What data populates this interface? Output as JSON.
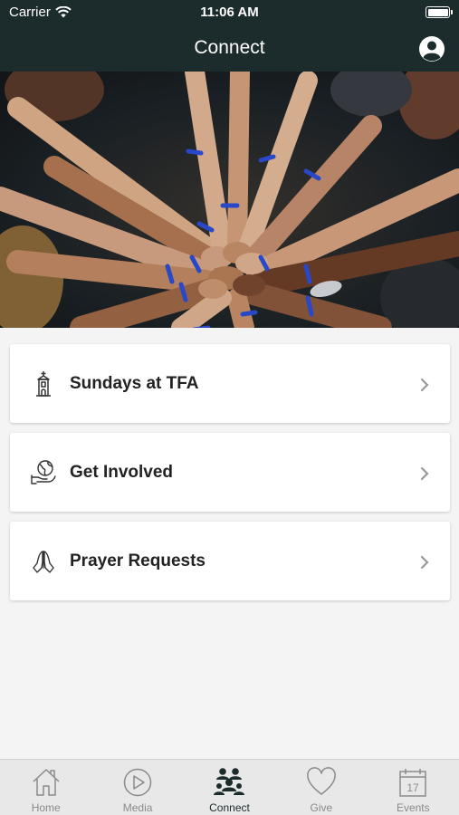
{
  "status_bar": {
    "carrier": "Carrier",
    "time": "11:06 AM"
  },
  "nav": {
    "title": "Connect"
  },
  "cards": [
    {
      "label": "Sundays at TFA",
      "icon": "church-icon"
    },
    {
      "label": "Get Involved",
      "icon": "globe-hand-icon"
    },
    {
      "label": "Prayer Requests",
      "icon": "praying-hands-icon"
    }
  ],
  "tabs": [
    {
      "label": "Home",
      "icon": "home-icon",
      "active": false
    },
    {
      "label": "Media",
      "icon": "play-icon",
      "active": false
    },
    {
      "label": "Connect",
      "icon": "people-icon",
      "active": true
    },
    {
      "label": "Give",
      "icon": "heart-icon",
      "active": false
    },
    {
      "label": "Events",
      "icon": "calendar-icon",
      "active": false
    }
  ],
  "calendar_day": "17",
  "colors": {
    "header": "#1c2b2b",
    "tab_active": "#1c2b2b",
    "tab_inactive": "#8a8a8a"
  }
}
